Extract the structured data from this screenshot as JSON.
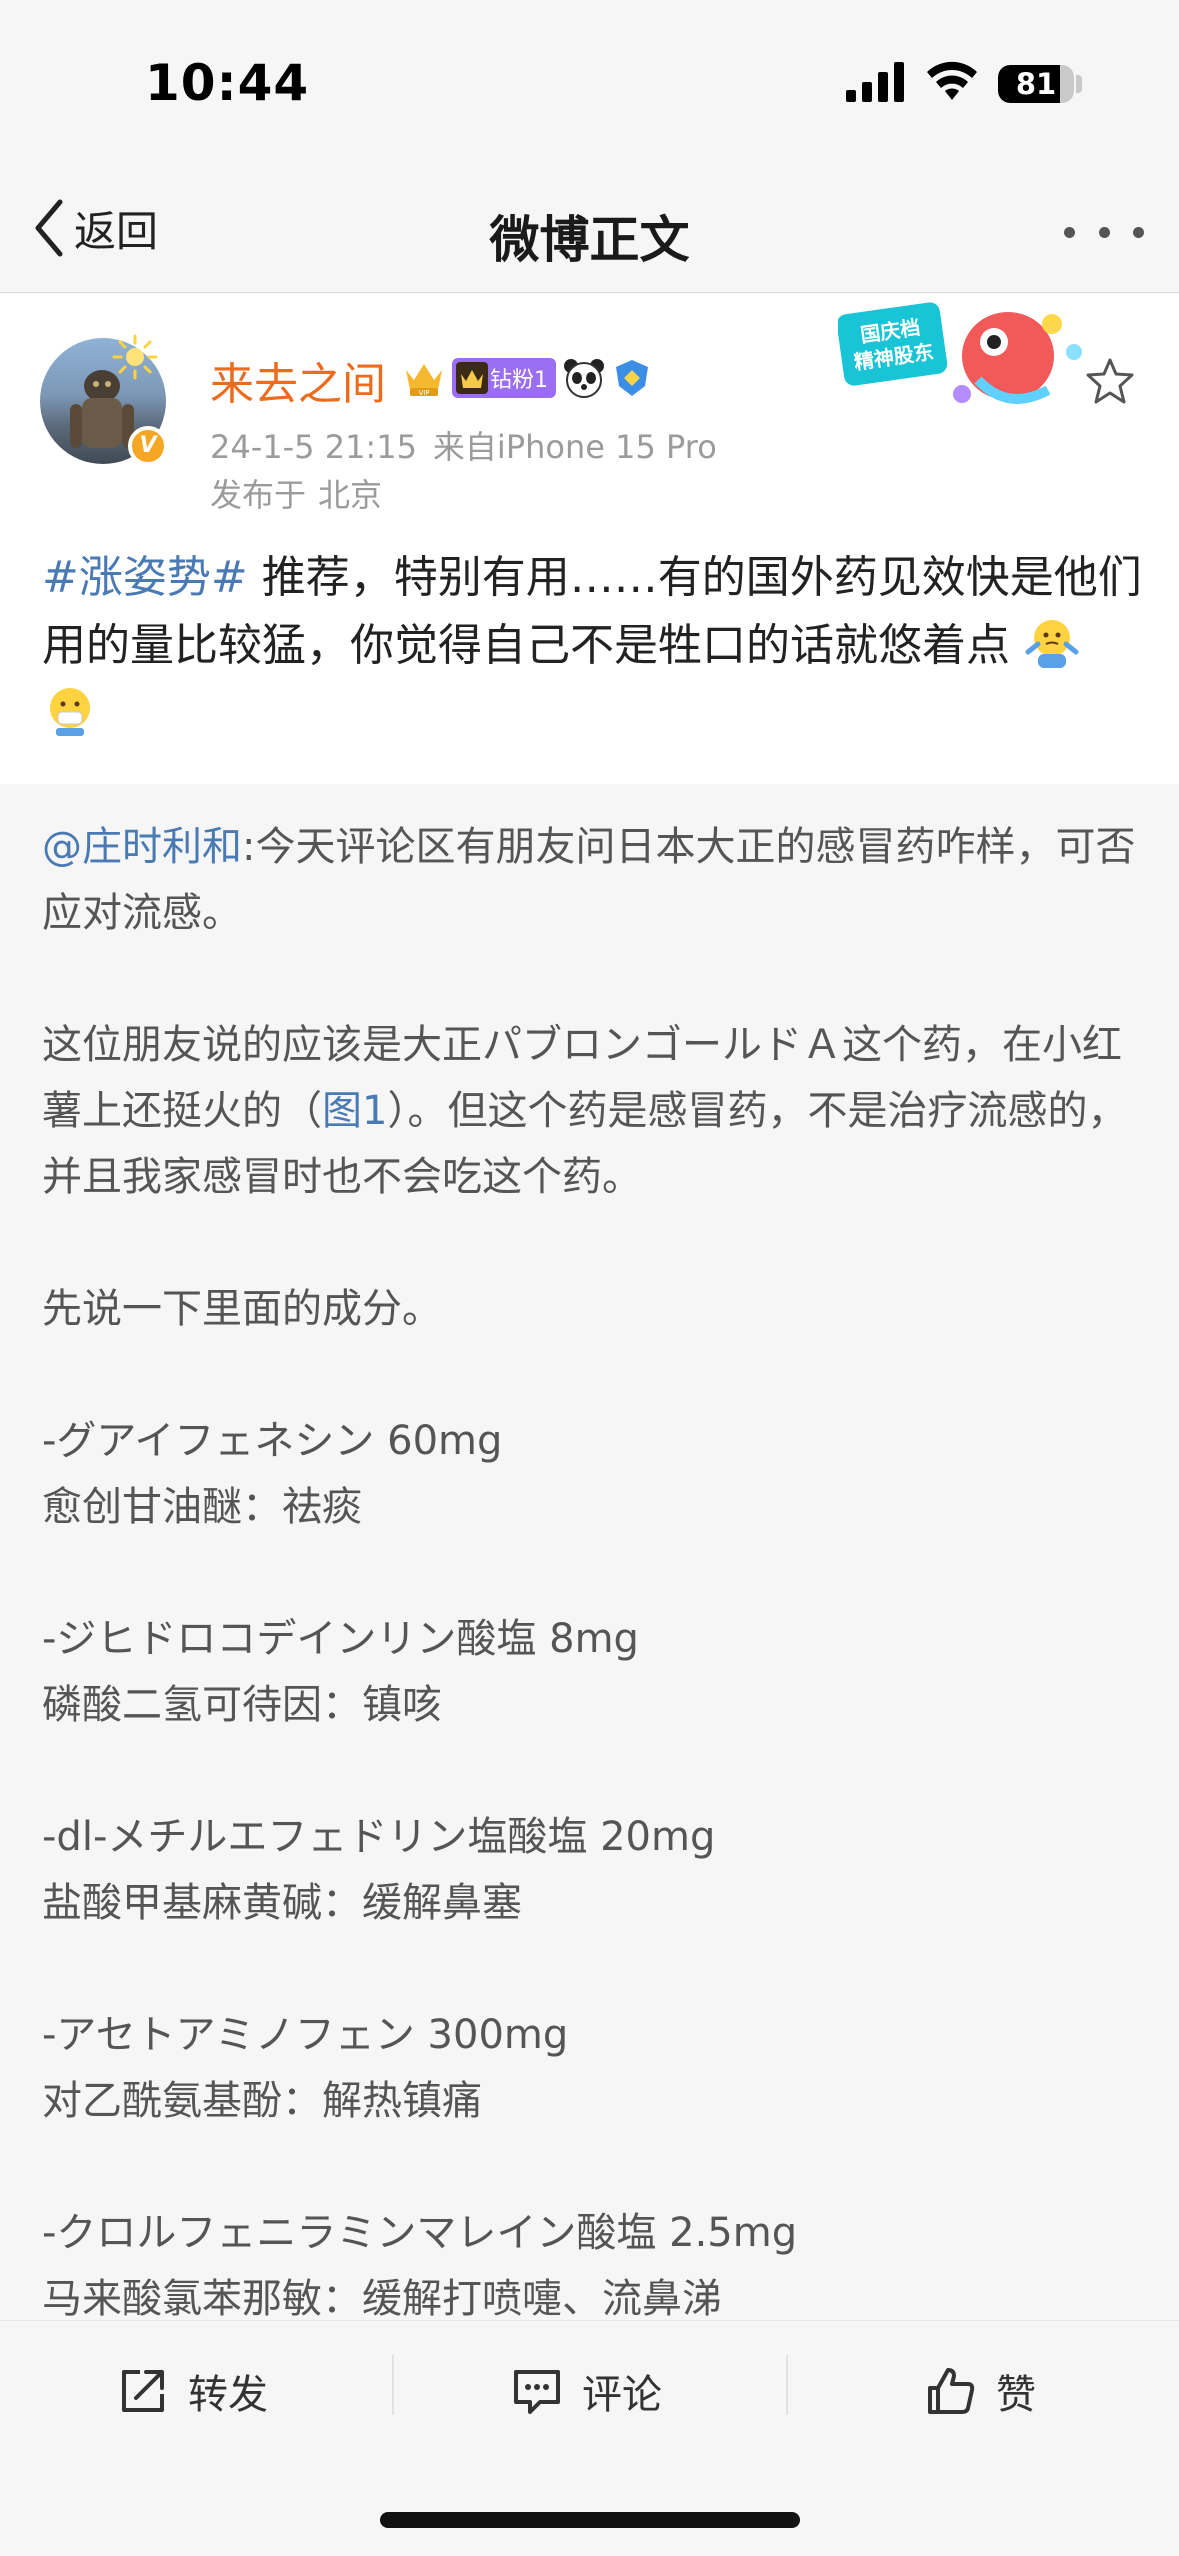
{
  "status_bar": {
    "time": "10:44",
    "battery_level": "81",
    "battery_fraction": 0.81,
    "icons": [
      "cellular-signal-icon",
      "wifi-icon",
      "battery-icon"
    ]
  },
  "nav": {
    "back_label": "返回",
    "title": "微博正文",
    "more_icon": "more-dots-icon"
  },
  "post": {
    "author": "来去之间",
    "fan_badge": "钻粉1",
    "timestamp": "24-1-5 21:15",
    "source": "来自iPhone 15 Pro",
    "location_prefix": "发布于",
    "location": "北京",
    "promo_banner_text": "国庆档精神股东",
    "hashtag": "#涨姿势#",
    "text": " 推荐，特别有用……有的国外药见效快是他们用的量比较猛，你觉得自己不是牲口的话就悠着点"
  },
  "quoted": {
    "mention": "@庄时利和",
    "intro": ":今天评论区有朋友问日本大正的感冒药咋样，可否应对流感。",
    "para2_before": "这位朋友说的应该是大正パブロンゴールドＡ这个药，在小红薯上还挺火的（",
    "para2_link": "图1",
    "para2_after": "）。但这个药是感冒药，不是治疗流感的，并且我家感冒时也不会吃这个药。",
    "para3": "先说一下里面的成分。",
    "ingredients": [
      {
        "jp": "-グアイフェネシン 60mg",
        "cn": "愈创甘油醚：祛痰"
      },
      {
        "jp": "-ジヒドロコデインリン酸塩 8mg",
        "cn": "磷酸二氢可待因：镇咳"
      },
      {
        "jp": "-dl-メチルエフェドリン塩酸塩 20mg",
        "cn": "盐酸甲基麻黄碱：缓解鼻塞"
      },
      {
        "jp": "-アセトアミノフェン 300mg",
        "cn": "对乙酰氨基酚：解热镇痛"
      },
      {
        "jp": "-クロルフェニラミンマレイン酸塩 2.5mg",
        "cn": "马来酸氯苯那敏：缓解打喷嚏、流鼻涕"
      }
    ]
  },
  "actions": {
    "repost": "转发",
    "comment": "评论",
    "like": "赞"
  },
  "colors": {
    "username": "#ec6b1c",
    "link": "#4a7ab3",
    "meta": "#9b9b9b"
  }
}
